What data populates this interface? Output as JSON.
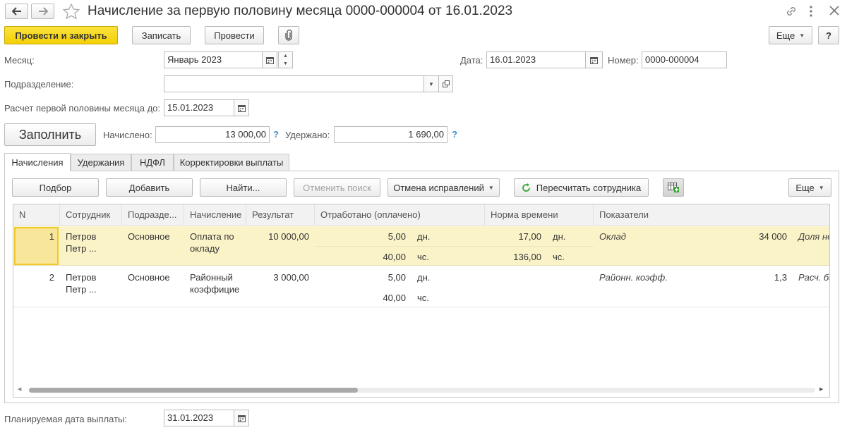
{
  "window": {
    "title": "Начисление за первую половину месяца 0000-000004 от 16.01.2023"
  },
  "toolbar": {
    "post_close": "Провести и закрыть",
    "save": "Записать",
    "post": "Провести",
    "more": "Еще",
    "help": "?"
  },
  "form": {
    "month_label": "Месяц:",
    "month_value": "Январь 2023",
    "date_label": "Дата:",
    "date_value": "16.01.2023",
    "number_label": "Номер:",
    "number_value": "0000-000004",
    "division_label": "Подразделение:",
    "division_value": "",
    "calc_until_label": "Расчет первой половины месяца до:",
    "calc_until_value": "15.01.2023",
    "fill_button": "Заполнить",
    "accrued_label": "Начислено:",
    "accrued_value": "13 000,00",
    "withheld_label": "Удержано:",
    "withheld_value": "1 690,00",
    "help_mark": "?",
    "pay_date_label": "Планируемая дата выплаты:",
    "pay_date_value": "31.01.2023"
  },
  "tabs": [
    "Начисления",
    "Удержания",
    "НДФЛ",
    "Корректировки выплаты"
  ],
  "table_toolbar": {
    "pick": "Подбор",
    "add": "Добавить",
    "find": "Найти...",
    "cancel_search": "Отменить поиск",
    "cancel_corrections": "Отмена исправлений",
    "recalc": "Пересчитать сотрудника",
    "more": "Еще"
  },
  "table": {
    "headers": [
      "N",
      "Сотрудник",
      "Подразде...",
      "Начисление",
      "Результат",
      "Отработано (оплачено)",
      "Норма времени",
      "Показатели"
    ],
    "rows": [
      {
        "n": "1",
        "employee_1": "Петров",
        "employee_2": "Петр ...",
        "division": "Основное",
        "accrual_1": "Оплата по",
        "accrual_2": "окладу",
        "result": "10 000,00",
        "worked_days": "5,00",
        "worked_days_unit": "дн.",
        "worked_hours": "40,00",
        "worked_hours_unit": "чс.",
        "norm_days": "17,00",
        "norm_days_unit": "дн.",
        "norm_hours": "136,00",
        "norm_hours_unit": "чс.",
        "indicator_name": "Оклад",
        "indicator_value": "34 000",
        "indicator_next": "Доля не"
      },
      {
        "n": "2",
        "employee_1": "Петров",
        "employee_2": "Петр ...",
        "division": "Основное",
        "accrual_1": "Районный",
        "accrual_2": "коэффицие",
        "result": "3 000,00",
        "worked_days": "5,00",
        "worked_days_unit": "дн.",
        "worked_hours": "40,00",
        "worked_hours_unit": "чс.",
        "norm_days": "",
        "norm_days_unit": "",
        "norm_hours": "",
        "norm_hours_unit": "",
        "indicator_name": "Районн. коэфф.",
        "indicator_value": "1,3",
        "indicator_next": "Расч. ба"
      }
    ]
  },
  "colors": {
    "primary_button": "#f3cf06",
    "selected_row": "#fbf3c8",
    "selected_cell": "#f8e69a",
    "help_accent": "#3d8fd3",
    "recalc_icon": "#3aa336"
  },
  "icons": [
    "back-arrow-icon",
    "forward-arrow-icon",
    "star-icon",
    "link-icon",
    "menu-dots-icon",
    "close-icon",
    "paperclip-icon",
    "calendar-icon",
    "dropdown-icon",
    "open-icon",
    "refresh-icon",
    "table-add-icon"
  ]
}
